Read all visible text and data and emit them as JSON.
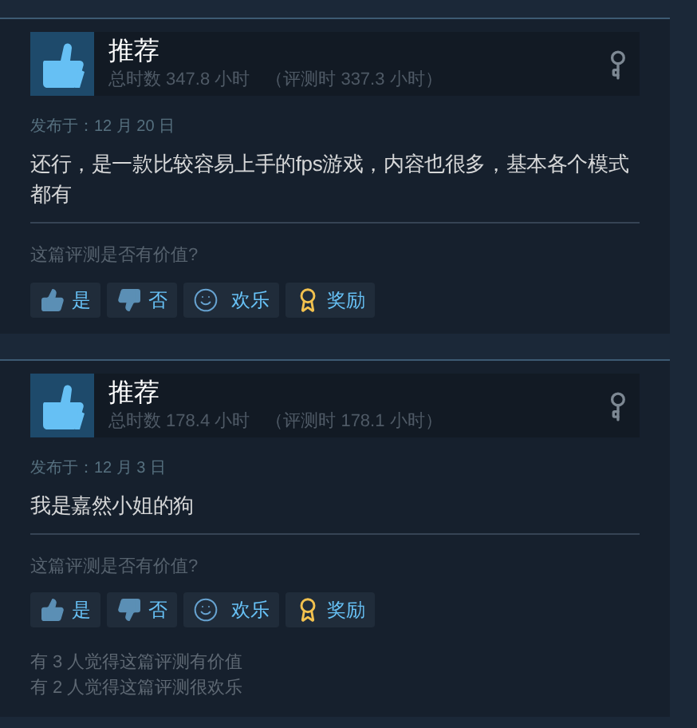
{
  "reviews": [
    {
      "title": "推荐",
      "hours": "总时数 347.8 小时",
      "review_hours": "（评测时 337.3 小时）",
      "date": "发布于：12 月 20 日",
      "text": "还行，是一款比较容易上手的fps游戏，内容也很多，基本各个模式都有",
      "question": "这篇评测是否有价值?",
      "buttons": [
        {
          "kind": "yes",
          "label": "是"
        },
        {
          "kind": "no",
          "label": "否"
        },
        {
          "kind": "funny",
          "label": "欢乐"
        },
        {
          "kind": "award",
          "label": "奖励"
        }
      ]
    },
    {
      "title": "推荐",
      "hours": "总时数 178.4 小时",
      "review_hours": "（评测时 178.1 小时）",
      "date": "发布于：12 月 3 日",
      "text": "我是嘉然小姐的狗",
      "question": "这篇评测是否有价值?",
      "buttons": [
        {
          "kind": "yes",
          "label": "是"
        },
        {
          "kind": "no",
          "label": "否"
        },
        {
          "kind": "funny",
          "label": "欢乐"
        },
        {
          "kind": "award",
          "label": "奖励"
        }
      ],
      "footer": [
        "有 3 人觉得这篇评测有价值",
        "有 2 人觉得这篇评测很欢乐"
      ]
    }
  ]
}
